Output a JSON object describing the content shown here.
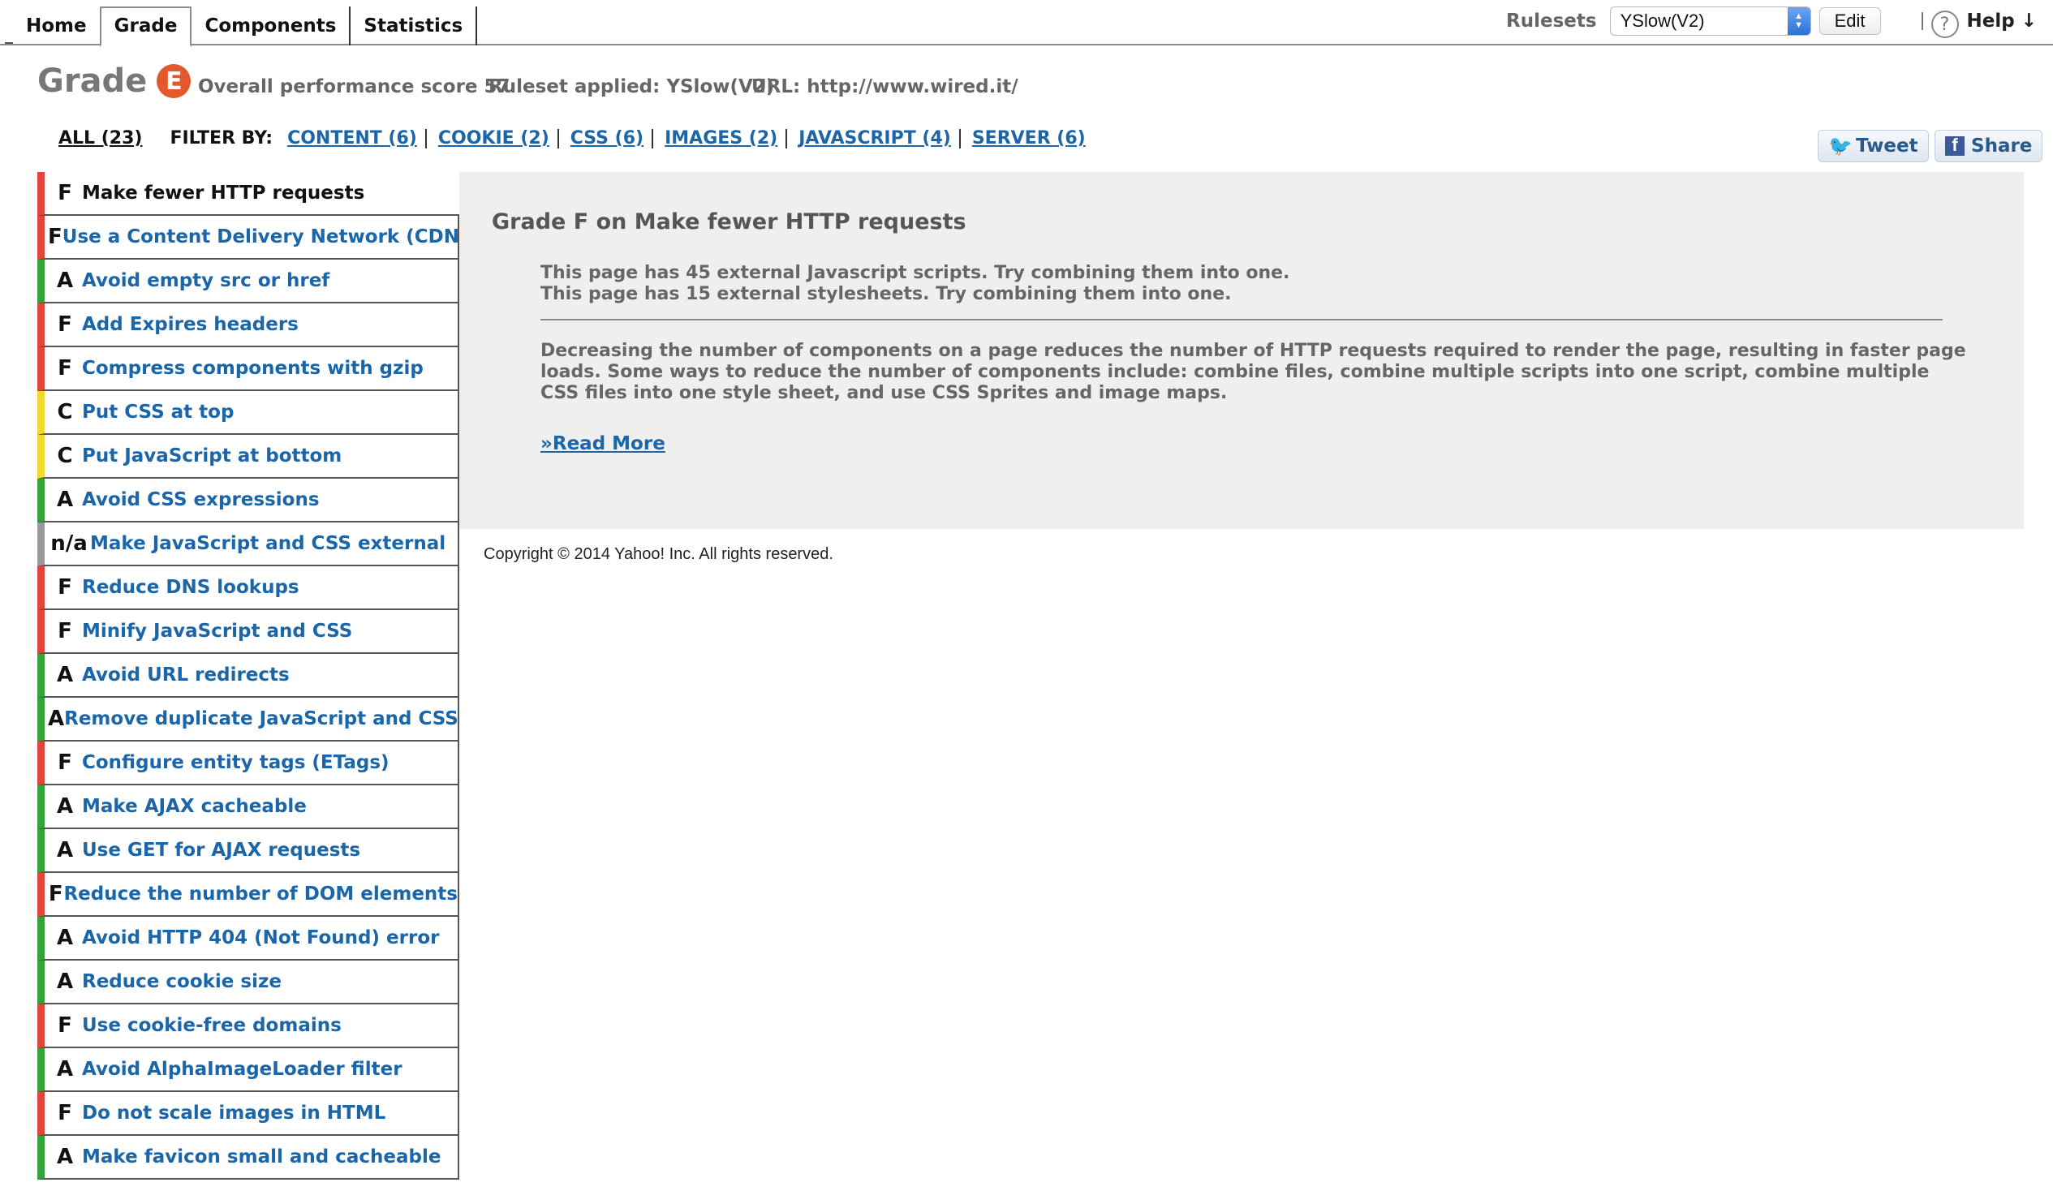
{
  "nav": {
    "tabs": [
      "Home",
      "Grade",
      "Components",
      "Statistics"
    ],
    "active_tab": "Grade"
  },
  "rulesets": {
    "label": "Rulesets",
    "selected": "YSlow(V2)",
    "edit_label": "Edit",
    "help_icon": "question-icon",
    "help_label": "Help ↓"
  },
  "grade": {
    "word": "Grade",
    "letter": "E",
    "badge_color": "#e4582d",
    "score_text": "Overall performance score 57",
    "ruleset_text": "Ruleset applied: YSlow(V2)",
    "url_text": "URL: http://www.wired.it/"
  },
  "filters": {
    "all": "ALL (23)",
    "filter_by": "FILTER BY:",
    "items": [
      "CONTENT (6)",
      "COOKIE (2)",
      "CSS (6)",
      "IMAGES (2)",
      "JAVASCRIPT (4)",
      "SERVER (6)"
    ]
  },
  "social": {
    "tweet": "Tweet",
    "share": "Share"
  },
  "grade_colors": {
    "F": "#e2453c",
    "A": "#34a33a",
    "C": "#f1d930",
    "n/a": "#9a9a9a"
  },
  "rules": [
    {
      "grade": "F",
      "name": "Make fewer HTTP requests"
    },
    {
      "grade": "F",
      "name": "Use a Content Delivery Network (CDN)"
    },
    {
      "grade": "A",
      "name": "Avoid empty src or href"
    },
    {
      "grade": "F",
      "name": "Add Expires headers"
    },
    {
      "grade": "F",
      "name": "Compress components with gzip"
    },
    {
      "grade": "C",
      "name": "Put CSS at top"
    },
    {
      "grade": "C",
      "name": "Put JavaScript at bottom"
    },
    {
      "grade": "A",
      "name": "Avoid CSS expressions"
    },
    {
      "grade": "n/a",
      "name": "Make JavaScript and CSS external"
    },
    {
      "grade": "F",
      "name": "Reduce DNS lookups"
    },
    {
      "grade": "F",
      "name": "Minify JavaScript and CSS"
    },
    {
      "grade": "A",
      "name": "Avoid URL redirects"
    },
    {
      "grade": "A",
      "name": "Remove duplicate JavaScript and CSS"
    },
    {
      "grade": "F",
      "name": "Configure entity tags (ETags)"
    },
    {
      "grade": "A",
      "name": "Make AJAX cacheable"
    },
    {
      "grade": "A",
      "name": "Use GET for AJAX requests"
    },
    {
      "grade": "F",
      "name": "Reduce the number of DOM elements"
    },
    {
      "grade": "A",
      "name": "Avoid HTTP 404 (Not Found) error"
    },
    {
      "grade": "A",
      "name": "Reduce cookie size"
    },
    {
      "grade": "F",
      "name": "Use cookie-free domains"
    },
    {
      "grade": "A",
      "name": "Avoid AlphaImageLoader filter"
    },
    {
      "grade": "F",
      "name": "Do not scale images in HTML"
    },
    {
      "grade": "A",
      "name": "Make favicon small and cacheable"
    }
  ],
  "detail": {
    "title": "Grade F on Make fewer HTTP requests",
    "findings": [
      "This page has 45 external Javascript scripts. Try combining them into one.",
      "This page has 15 external stylesheets. Try combining them into one."
    ],
    "description": "Decreasing the number of components on a page reduces the number of HTTP requests required to render the page, resulting in faster page loads. Some ways to reduce the number of components include: combine files, combine multiple scripts into one script, combine multiple CSS files into one style sheet, and use CSS Sprites and image maps.",
    "read_more": "»Read More"
  },
  "footer": {
    "copyright": "Copyright © 2014 Yahoo! Inc. All rights reserved."
  }
}
